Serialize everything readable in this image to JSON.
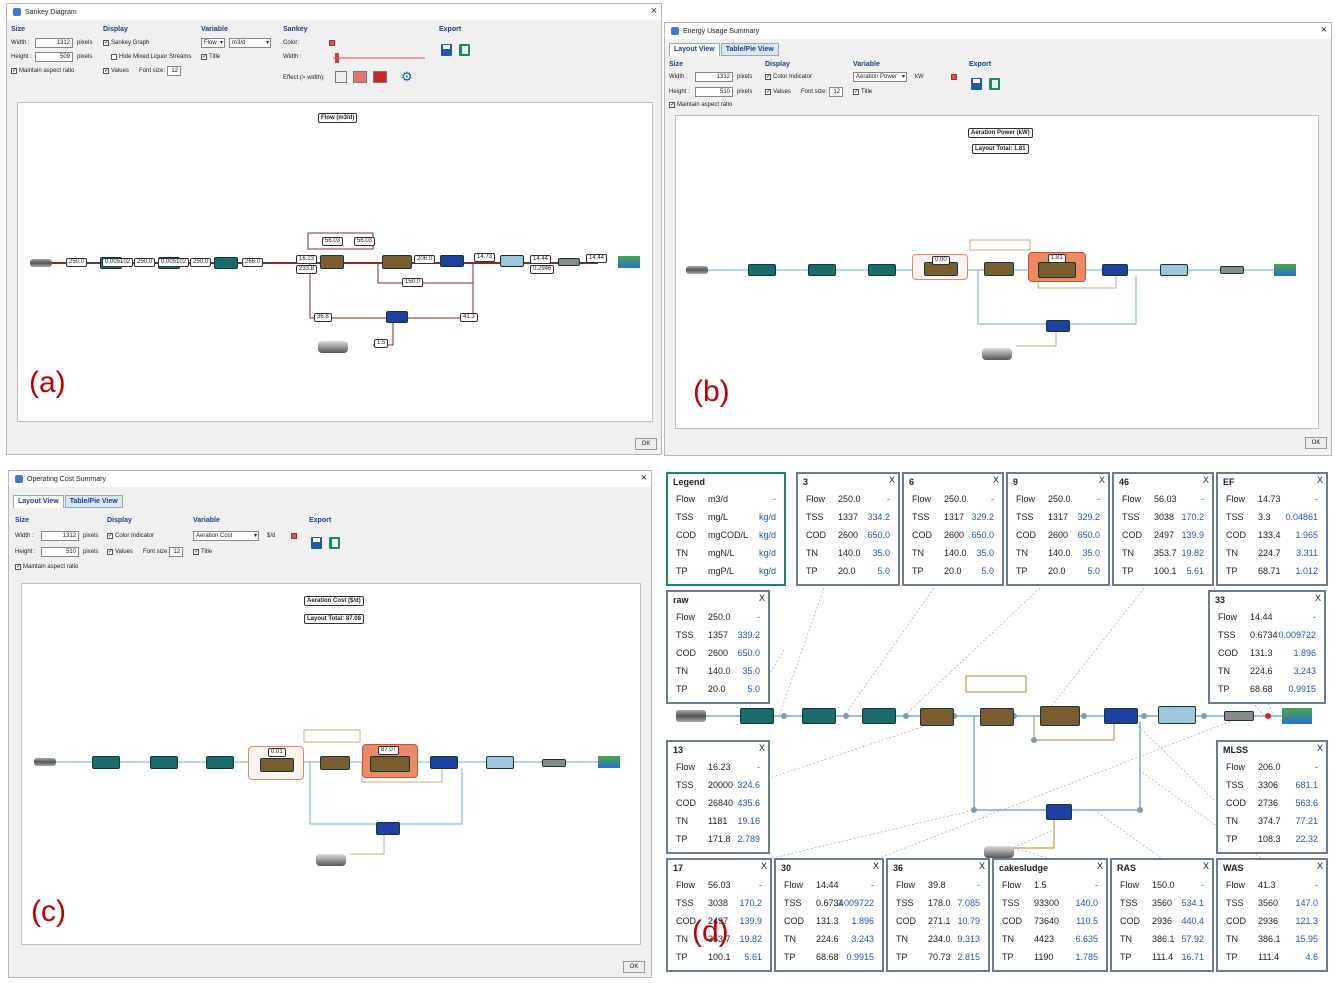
{
  "panels": {
    "a": {
      "label": "(a)",
      "title": "Sankey Diagram",
      "size": {
        "heading": "Size",
        "width_label": "Width :",
        "width": "1312",
        "height_label": "Height :",
        "height": "509",
        "unit": "pixels",
        "aspect": "Maintain aspect ratio"
      },
      "display": {
        "heading": "Display",
        "sankey_graph": "Sankey Graph",
        "hide_mixed": "Hide Mixed Liquor Streams",
        "title_cb": "Title",
        "values": "Values",
        "font_size_label": "Font size:",
        "font_size": "12"
      },
      "variable": {
        "heading": "Variable",
        "var": "Flow",
        "unit": "m3/d"
      },
      "sankey": {
        "heading": "Sankey",
        "color": "Color:",
        "width": "Width :",
        "effect": "Effect (> width):"
      },
      "export": {
        "heading": "Export"
      },
      "chart_title": "Flow (m3/d)",
      "flow_labels": [
        "250.0",
        "0.005102",
        "250.0",
        "0.005102",
        "250.0",
        "266.0",
        "16.23",
        "233.8",
        "56.03",
        "56.03",
        "206.0",
        "150.0",
        "14.73",
        "14.44",
        "0.2946",
        "14.44",
        "36.8",
        "41.3",
        "1.5"
      ],
      "ok": "OK"
    },
    "b": {
      "label": "(b)",
      "title": "Energy Usage Summary",
      "tabs": [
        "Layout View",
        "Table/Pie View"
      ],
      "size": {
        "heading": "Size",
        "width_label": "Width :",
        "width": "1312",
        "height_label": "Height :",
        "height": "510",
        "unit": "pixels",
        "aspect": "Maintain aspect ratio"
      },
      "display": {
        "heading": "Display",
        "color_indicator": "Color Indicator",
        "values": "Values",
        "font_size_label": "Font size:",
        "font_size": "12",
        "title_cb": "Title"
      },
      "variable": {
        "heading": "Variable",
        "var": "Aeration Power",
        "unit": "kW"
      },
      "export": {
        "heading": "Export"
      },
      "chart_title": "Aeration Power (kW)",
      "chart_total": "Layout Total: 1.81",
      "value_a": "0.00",
      "value_b": "1.81",
      "ok": "OK"
    },
    "c": {
      "label": "(c)",
      "title": "Operating Cost Summary",
      "tabs": [
        "Layout View",
        "Table/Pie View"
      ],
      "size": {
        "heading": "Size",
        "width_label": "Width :",
        "width": "1312",
        "height_label": "Height :",
        "height": "510",
        "unit": "pixels",
        "aspect": "Maintain aspect ratio"
      },
      "display": {
        "heading": "Display",
        "color_indicator": "Color Indicator",
        "values": "Values",
        "font_size_label": "Font size:",
        "font_size": "12",
        "title_cb": "Title"
      },
      "variable": {
        "heading": "Variable",
        "var": "Aeration Cost",
        "unit": "$/d"
      },
      "export": {
        "heading": "Export"
      },
      "chart_title": "Aeration Cost ($/d)",
      "chart_total": "Layout Total: 87.08",
      "value_a": "0.01",
      "value_b": "87.07",
      "ok": "OK"
    },
    "d": {
      "label": "(d)",
      "close": "X",
      "cards": [
        {
          "name": "Legend",
          "legend": true,
          "rows": [
            [
              "Flow",
              "m3/d",
              "-"
            ],
            [
              "TSS",
              "mg/L",
              "kg/d"
            ],
            [
              "COD",
              "mgCOD/L",
              "kg/d"
            ],
            [
              "TN",
              "mgN/L",
              "kg/d"
            ],
            [
              "TP",
              "mgP/L",
              "kg/d"
            ]
          ]
        },
        {
          "name": "3",
          "rows": [
            [
              "Flow",
              "250.0",
              "-"
            ],
            [
              "TSS",
              "1337",
              "334.2"
            ],
            [
              "COD",
              "2600",
              "650.0"
            ],
            [
              "TN",
              "140.0",
              "35.0"
            ],
            [
              "TP",
              "20.0",
              "5.0"
            ]
          ]
        },
        {
          "name": "6",
          "rows": [
            [
              "Flow",
              "250.0",
              "-"
            ],
            [
              "TSS",
              "1317",
              "329.2"
            ],
            [
              "COD",
              "2600",
              "650.0"
            ],
            [
              "TN",
              "140.0",
              "35.0"
            ],
            [
              "TP",
              "20.0",
              "5.0"
            ]
          ]
        },
        {
          "name": "9",
          "rows": [
            [
              "Flow",
              "250.0",
              "-"
            ],
            [
              "TSS",
              "1317",
              "329.2"
            ],
            [
              "COD",
              "2600",
              "650.0"
            ],
            [
              "TN",
              "140.0",
              "35.0"
            ],
            [
              "TP",
              "20.0",
              "5.0"
            ]
          ]
        },
        {
          "name": "46",
          "rows": [
            [
              "Flow",
              "56.03",
              "-"
            ],
            [
              "TSS",
              "3038",
              "170.2"
            ],
            [
              "COD",
              "2497",
              "139.9"
            ],
            [
              "TN",
              "353.7",
              "19.82"
            ],
            [
              "TP",
              "100.1",
              "5.61"
            ]
          ]
        },
        {
          "name": "EF",
          "rows": [
            [
              "Flow",
              "14.73",
              "-"
            ],
            [
              "TSS",
              "3.3",
              "0.04861"
            ],
            [
              "COD",
              "133.4",
              "1.965"
            ],
            [
              "TN",
              "224.7",
              "3.311"
            ],
            [
              "TP",
              "68.71",
              "1.012"
            ]
          ]
        },
        {
          "name": "raw",
          "rows": [
            [
              "Flow",
              "250.0",
              "-"
            ],
            [
              "TSS",
              "1357",
              "339.2"
            ],
            [
              "COD",
              "2600",
              "650.0"
            ],
            [
              "TN",
              "140.0",
              "35.0"
            ],
            [
              "TP",
              "20.0",
              "5.0"
            ]
          ]
        },
        {
          "name": "33",
          "rows": [
            [
              "Flow",
              "14.44",
              "-"
            ],
            [
              "TSS",
              "0.6734",
              "0.009722"
            ],
            [
              "COD",
              "131.3",
              "1.896"
            ],
            [
              "TN",
              "224.6",
              "3.243"
            ],
            [
              "TP",
              "68.68",
              "0.9915"
            ]
          ]
        },
        {
          "name": "13",
          "rows": [
            [
              "Flow",
              "16.23",
              "-"
            ],
            [
              "TSS",
              "20000",
              "324.6"
            ],
            [
              "COD",
              "26840",
              "435.6"
            ],
            [
              "TN",
              "1181",
              "19.16"
            ],
            [
              "TP",
              "171.8",
              "2.789"
            ]
          ]
        },
        {
          "name": "MLSS",
          "rows": [
            [
              "Flow",
              "206.0",
              "-"
            ],
            [
              "TSS",
              "3306",
              "681.1"
            ],
            [
              "COD",
              "2736",
              "563.6"
            ],
            [
              "TN",
              "374.7",
              "77.21"
            ],
            [
              "TP",
              "108.3",
              "22.32"
            ]
          ]
        },
        {
          "name": "17",
          "rows": [
            [
              "Flow",
              "56.03",
              "-"
            ],
            [
              "TSS",
              "3038",
              "170.2"
            ],
            [
              "COD",
              "2497",
              "139.9"
            ],
            [
              "TN",
              "353.7",
              "19.82"
            ],
            [
              "TP",
              "100.1",
              "5.61"
            ]
          ]
        },
        {
          "name": "30",
          "rows": [
            [
              "Flow",
              "14.44",
              "-"
            ],
            [
              "TSS",
              "0.6734",
              "0.009722"
            ],
            [
              "COD",
              "131.3",
              "1.896"
            ],
            [
              "TN",
              "224.6",
              "3.243"
            ],
            [
              "TP",
              "68.68",
              "0.9915"
            ]
          ]
        },
        {
          "name": "36",
          "rows": [
            [
              "Flow",
              "39.8",
              "-"
            ],
            [
              "TSS",
              "178.0",
              "7.085"
            ],
            [
              "COD",
              "271.1",
              "10.79"
            ],
            [
              "TN",
              "234.0",
              "9.313"
            ],
            [
              "TP",
              "70.73",
              "2.815"
            ]
          ]
        },
        {
          "name": "cakesludge",
          "rows": [
            [
              "Flow",
              "1.5",
              "-"
            ],
            [
              "TSS",
              "93300",
              "140.0"
            ],
            [
              "COD",
              "73640",
              "110.5"
            ],
            [
              "TN",
              "4423",
              "6.635"
            ],
            [
              "TP",
              "1190",
              "1.785"
            ]
          ]
        },
        {
          "name": "RAS",
          "rows": [
            [
              "Flow",
              "150.0",
              "-"
            ],
            [
              "TSS",
              "3560",
              "534.1"
            ],
            [
              "COD",
              "2936",
              "440.4"
            ],
            [
              "TN",
              "386.1",
              "57.92"
            ],
            [
              "TP",
              "111.4",
              "16.71"
            ]
          ]
        },
        {
          "name": "WAS",
          "rows": [
            [
              "Flow",
              "41.3",
              "-"
            ],
            [
              "TSS",
              "3560",
              "147.0"
            ],
            [
              "COD",
              "2936",
              "121.3"
            ],
            [
              "TN",
              "386.1",
              "15.95"
            ],
            [
              "TP",
              "111.4",
              "4.6"
            ]
          ]
        }
      ]
    }
  }
}
